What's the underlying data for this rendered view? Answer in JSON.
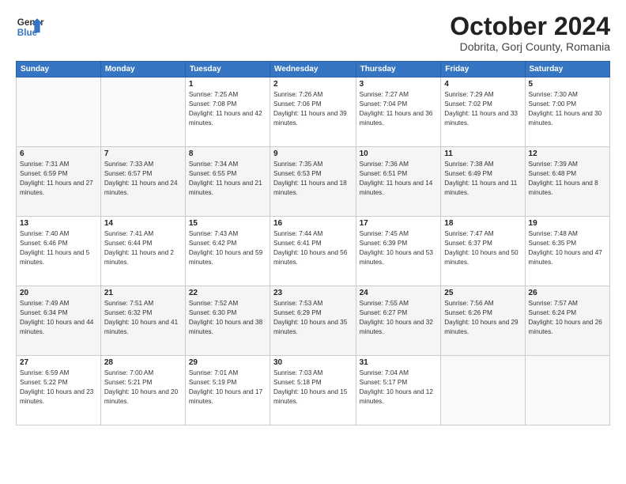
{
  "logo": {
    "line1": "General",
    "line2": "Blue"
  },
  "title": "October 2024",
  "location": "Dobrita, Gorj County, Romania",
  "weekdays": [
    "Sunday",
    "Monday",
    "Tuesday",
    "Wednesday",
    "Thursday",
    "Friday",
    "Saturday"
  ],
  "weeks": [
    [
      {
        "day": "",
        "info": ""
      },
      {
        "day": "",
        "info": ""
      },
      {
        "day": "1",
        "info": "Sunrise: 7:25 AM\nSunset: 7:08 PM\nDaylight: 11 hours and 42 minutes."
      },
      {
        "day": "2",
        "info": "Sunrise: 7:26 AM\nSunset: 7:06 PM\nDaylight: 11 hours and 39 minutes."
      },
      {
        "day": "3",
        "info": "Sunrise: 7:27 AM\nSunset: 7:04 PM\nDaylight: 11 hours and 36 minutes."
      },
      {
        "day": "4",
        "info": "Sunrise: 7:29 AM\nSunset: 7:02 PM\nDaylight: 11 hours and 33 minutes."
      },
      {
        "day": "5",
        "info": "Sunrise: 7:30 AM\nSunset: 7:00 PM\nDaylight: 11 hours and 30 minutes."
      }
    ],
    [
      {
        "day": "6",
        "info": "Sunrise: 7:31 AM\nSunset: 6:59 PM\nDaylight: 11 hours and 27 minutes."
      },
      {
        "day": "7",
        "info": "Sunrise: 7:33 AM\nSunset: 6:57 PM\nDaylight: 11 hours and 24 minutes."
      },
      {
        "day": "8",
        "info": "Sunrise: 7:34 AM\nSunset: 6:55 PM\nDaylight: 11 hours and 21 minutes."
      },
      {
        "day": "9",
        "info": "Sunrise: 7:35 AM\nSunset: 6:53 PM\nDaylight: 11 hours and 18 minutes."
      },
      {
        "day": "10",
        "info": "Sunrise: 7:36 AM\nSunset: 6:51 PM\nDaylight: 11 hours and 14 minutes."
      },
      {
        "day": "11",
        "info": "Sunrise: 7:38 AM\nSunset: 6:49 PM\nDaylight: 11 hours and 11 minutes."
      },
      {
        "day": "12",
        "info": "Sunrise: 7:39 AM\nSunset: 6:48 PM\nDaylight: 11 hours and 8 minutes."
      }
    ],
    [
      {
        "day": "13",
        "info": "Sunrise: 7:40 AM\nSunset: 6:46 PM\nDaylight: 11 hours and 5 minutes."
      },
      {
        "day": "14",
        "info": "Sunrise: 7:41 AM\nSunset: 6:44 PM\nDaylight: 11 hours and 2 minutes."
      },
      {
        "day": "15",
        "info": "Sunrise: 7:43 AM\nSunset: 6:42 PM\nDaylight: 10 hours and 59 minutes."
      },
      {
        "day": "16",
        "info": "Sunrise: 7:44 AM\nSunset: 6:41 PM\nDaylight: 10 hours and 56 minutes."
      },
      {
        "day": "17",
        "info": "Sunrise: 7:45 AM\nSunset: 6:39 PM\nDaylight: 10 hours and 53 minutes."
      },
      {
        "day": "18",
        "info": "Sunrise: 7:47 AM\nSunset: 6:37 PM\nDaylight: 10 hours and 50 minutes."
      },
      {
        "day": "19",
        "info": "Sunrise: 7:48 AM\nSunset: 6:35 PM\nDaylight: 10 hours and 47 minutes."
      }
    ],
    [
      {
        "day": "20",
        "info": "Sunrise: 7:49 AM\nSunset: 6:34 PM\nDaylight: 10 hours and 44 minutes."
      },
      {
        "day": "21",
        "info": "Sunrise: 7:51 AM\nSunset: 6:32 PM\nDaylight: 10 hours and 41 minutes."
      },
      {
        "day": "22",
        "info": "Sunrise: 7:52 AM\nSunset: 6:30 PM\nDaylight: 10 hours and 38 minutes."
      },
      {
        "day": "23",
        "info": "Sunrise: 7:53 AM\nSunset: 6:29 PM\nDaylight: 10 hours and 35 minutes."
      },
      {
        "day": "24",
        "info": "Sunrise: 7:55 AM\nSunset: 6:27 PM\nDaylight: 10 hours and 32 minutes."
      },
      {
        "day": "25",
        "info": "Sunrise: 7:56 AM\nSunset: 6:26 PM\nDaylight: 10 hours and 29 minutes."
      },
      {
        "day": "26",
        "info": "Sunrise: 7:57 AM\nSunset: 6:24 PM\nDaylight: 10 hours and 26 minutes."
      }
    ],
    [
      {
        "day": "27",
        "info": "Sunrise: 6:59 AM\nSunset: 5:22 PM\nDaylight: 10 hours and 23 minutes."
      },
      {
        "day": "28",
        "info": "Sunrise: 7:00 AM\nSunset: 5:21 PM\nDaylight: 10 hours and 20 minutes."
      },
      {
        "day": "29",
        "info": "Sunrise: 7:01 AM\nSunset: 5:19 PM\nDaylight: 10 hours and 17 minutes."
      },
      {
        "day": "30",
        "info": "Sunrise: 7:03 AM\nSunset: 5:18 PM\nDaylight: 10 hours and 15 minutes."
      },
      {
        "day": "31",
        "info": "Sunrise: 7:04 AM\nSunset: 5:17 PM\nDaylight: 10 hours and 12 minutes."
      },
      {
        "day": "",
        "info": ""
      },
      {
        "day": "",
        "info": ""
      }
    ]
  ]
}
